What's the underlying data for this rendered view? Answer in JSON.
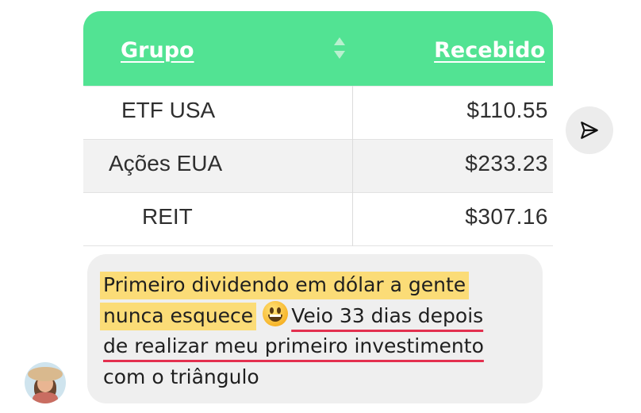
{
  "table": {
    "headers": {
      "grupo": "Grupo",
      "recebido": "Recebido"
    },
    "rows": [
      {
        "grupo": "ETF USA",
        "recebido": "$110.55"
      },
      {
        "grupo": "Ações EUA",
        "recebido": "$233.23"
      },
      {
        "grupo": "REIT",
        "recebido": "$307.16"
      }
    ],
    "header_color": "#52e393"
  },
  "share_button": {
    "icon": "paper-plane-icon"
  },
  "message": {
    "line1_highlight": "Primeiro dividendo em dólar a gente",
    "line2_highlight": "nunca esquece",
    "emoji": "grinning-face-emoji",
    "line2_underlined": "Veio 33 dias depois",
    "line3_underlined": "de realizar meu primeiro investimento",
    "line4": "com o triângulo",
    "highlight_color": "#fbdc77",
    "underline_color": "#e3304f"
  },
  "avatar": {
    "icon": "user-avatar"
  }
}
